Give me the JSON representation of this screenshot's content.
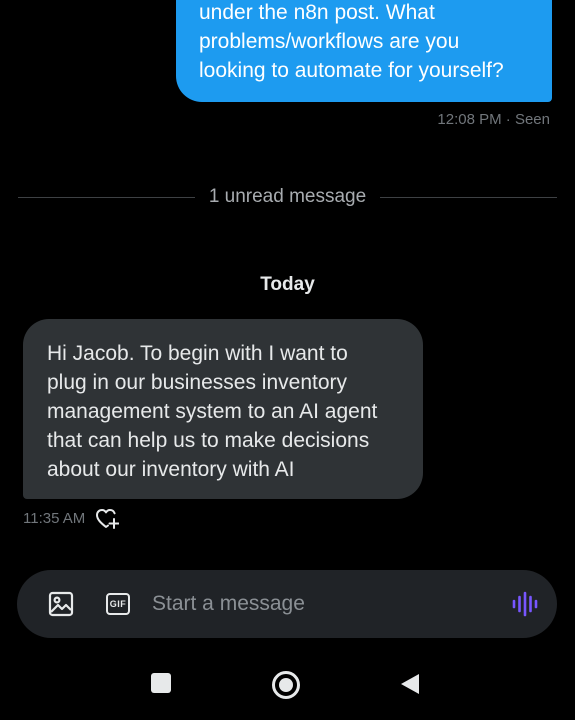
{
  "conversation": {
    "sent_message": {
      "lines": [
        "under the n8n post. What",
        "problems/workflows are you",
        "looking to automate for yourself?"
      ],
      "meta": "12:08 PM · Seen"
    },
    "unread_divider": "1 unread message",
    "day_label": "Today",
    "received_message": {
      "lines": [
        "Hi Jacob. To begin with I want to",
        "plug in our businesses inventory",
        "management system to an AI agent",
        "that can help us to make decisions",
        "about our inventory with AI"
      ],
      "time": "11:35 AM"
    }
  },
  "composer": {
    "placeholder": "Start a message",
    "gif_label": "GIF"
  },
  "icons": {
    "media": "image-icon",
    "gif": "gif-icon",
    "voice": "voice-wave-icon",
    "react": "heart-plus-icon",
    "nav_recents": "square-icon",
    "nav_home": "circle-icon",
    "nav_back": "triangle-back-icon"
  },
  "colors": {
    "sent_bubble": "#1d9bf0",
    "received_bubble": "#2f3336",
    "voice_accent": "#7856ff",
    "background": "#000000"
  }
}
